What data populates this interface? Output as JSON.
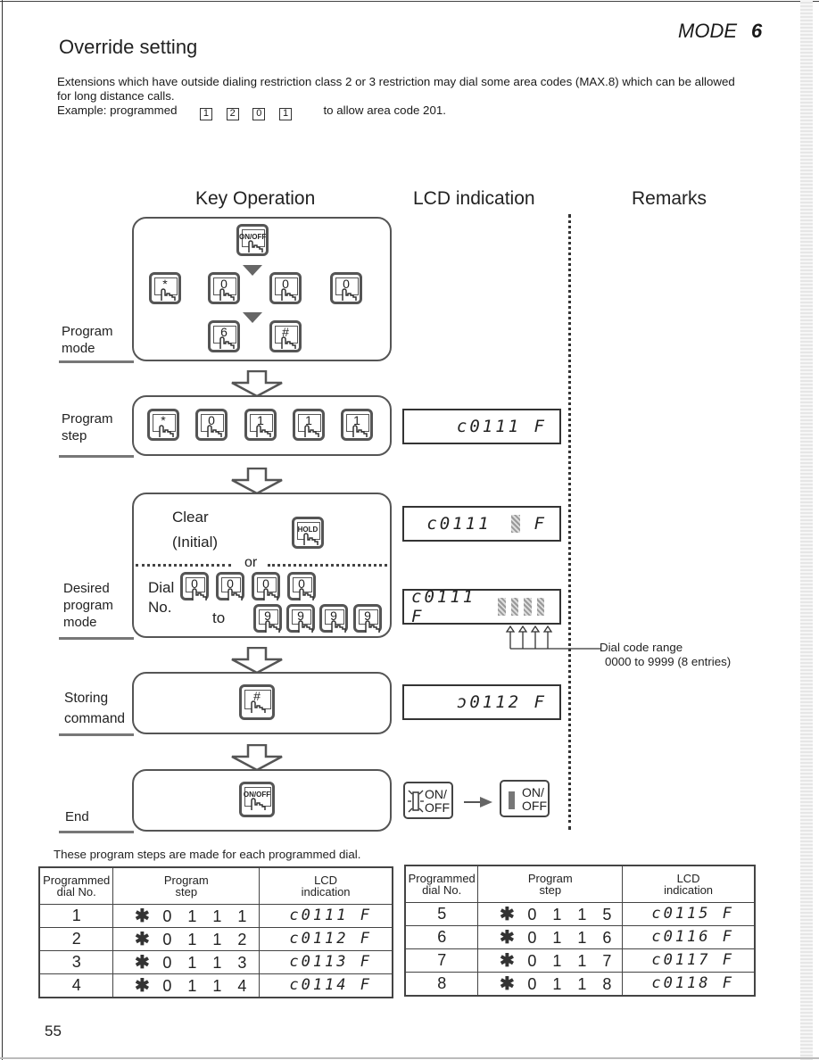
{
  "header": {
    "title": "Override setting",
    "mode_label": "MODE",
    "mode_number": "6"
  },
  "intro": {
    "line1": "Extensions which have outside dialing restriction class 2 or 3 restriction may dial some area codes (MAX.8) which can be allowed",
    "line2": "for long distance calls.",
    "example_prefix": "Example: programmed",
    "example_keys": [
      "1",
      "2",
      "0",
      "1"
    ],
    "example_suffix": "to allow area code 201."
  },
  "columns": {
    "key_operation": "Key Operation",
    "lcd_indication": "LCD indication",
    "remarks": "Remarks"
  },
  "steps": {
    "program_mode": {
      "label_line1": "Program",
      "label_line2": "mode",
      "keys_row1": [
        "ON/OFF"
      ],
      "keys_row2": [
        "*",
        "0",
        "0",
        "0"
      ],
      "keys_row3": [
        "6",
        "#"
      ]
    },
    "program_step": {
      "label_line1": "Program",
      "label_line2": "step",
      "keys": [
        "*",
        "0",
        "1",
        "1",
        "1"
      ],
      "lcd": "c0111 F"
    },
    "desired_program_mode": {
      "label_line1": "Desired",
      "label_line2": "program",
      "label_line3": "mode",
      "clear_line1": "Clear",
      "clear_line2": "(Initial)",
      "clear_key": "HOLD",
      "or_label": "or",
      "dial_line1": "Dial",
      "dial_line2": "No.",
      "to_label": "to",
      "dial_from_keys": [
        "0",
        "0",
        "0",
        "0"
      ],
      "dial_to_keys": [
        "9",
        "9",
        "9",
        "9"
      ],
      "lcd_clear": "c0111",
      "lcd_clear_suffix": "F",
      "lcd_dial": "c0111 F",
      "dial_code_range_label": "Dial code range",
      "dial_code_range_value": "0000 to 9999 (8 entries)"
    },
    "storing_command": {
      "label_line1": "Storing",
      "label_line2": "command",
      "key": "#",
      "lcd": "ɔ0112 F"
    },
    "end": {
      "label": "End",
      "key": "ON/OFF",
      "indicator_before_line1": "ON/",
      "indicator_before_line2": "OFF",
      "indicator_after_line1": "ON/",
      "indicator_after_line2": "OFF"
    }
  },
  "table_note": "These program steps are made for each programmed dial.",
  "tables": {
    "headers": {
      "dial_no": [
        "Programmed",
        "dial No."
      ],
      "program_step": [
        "Program",
        "step"
      ],
      "lcd": [
        "LCD",
        "indication"
      ]
    },
    "left": [
      {
        "dial": "1",
        "step": [
          "✱",
          "0",
          "1",
          "1",
          "1"
        ],
        "lcd": "c0111 F"
      },
      {
        "dial": "2",
        "step": [
          "✱",
          "0",
          "1",
          "1",
          "2"
        ],
        "lcd": "c0112 F"
      },
      {
        "dial": "3",
        "step": [
          "✱",
          "0",
          "1",
          "1",
          "3"
        ],
        "lcd": "c0113 F"
      },
      {
        "dial": "4",
        "step": [
          "✱",
          "0",
          "1",
          "1",
          "4"
        ],
        "lcd": "c0114 F"
      }
    ],
    "right": [
      {
        "dial": "5",
        "step": [
          "✱",
          "0",
          "1",
          "1",
          "5"
        ],
        "lcd": "c0115 F"
      },
      {
        "dial": "6",
        "step": [
          "✱",
          "0",
          "1",
          "1",
          "6"
        ],
        "lcd": "c0116 F"
      },
      {
        "dial": "7",
        "step": [
          "✱",
          "0",
          "1",
          "1",
          "7"
        ],
        "lcd": "c0117 F"
      },
      {
        "dial": "8",
        "step": [
          "✱",
          "0",
          "1",
          "1",
          "8"
        ],
        "lcd": "c0118 F"
      }
    ]
  },
  "footer": {
    "page_number": "55"
  }
}
